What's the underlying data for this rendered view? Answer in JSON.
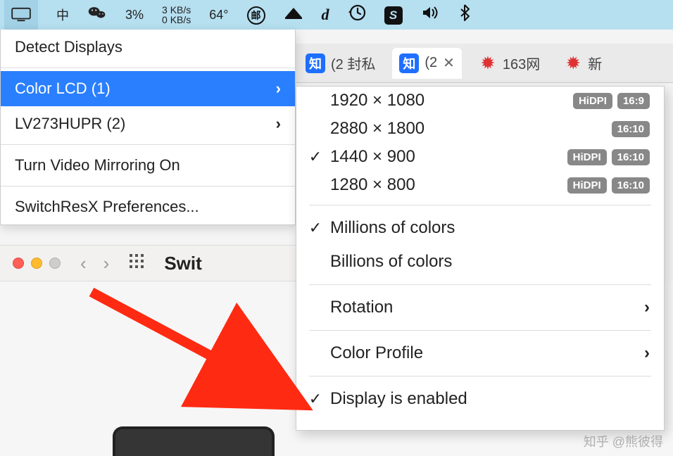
{
  "menubar": {
    "input_method": "中",
    "battery_pct": "3%",
    "net_up": "3 KB/s",
    "net_down": "0 KB/s",
    "temperature": "64°",
    "mail_icon": "邮",
    "d_icon": "d",
    "s_icon": "S"
  },
  "left_menu": {
    "detect": "Detect Displays",
    "displays": [
      {
        "label": "Color LCD (1)",
        "selected": true
      },
      {
        "label": "LV273HUPR (2)",
        "selected": false
      }
    ],
    "mirror": "Turn Video Mirroring On",
    "prefs": "SwitchResX Preferences..."
  },
  "right_menu": {
    "resolutions": [
      {
        "label": "1920 × 1080",
        "checked": false,
        "badges": [
          "HiDPI",
          "16:9"
        ]
      },
      {
        "label": "2880 × 1800",
        "checked": false,
        "badges": [
          "16:10"
        ]
      },
      {
        "label": "1440 × 900",
        "checked": true,
        "badges": [
          "HiDPI",
          "16:10"
        ]
      },
      {
        "label": "1280 × 800",
        "checked": false,
        "badges": [
          "HiDPI",
          "16:10"
        ]
      }
    ],
    "colors": [
      {
        "label": "Millions of colors",
        "checked": true
      },
      {
        "label": "Billions of colors",
        "checked": false
      }
    ],
    "rotation": "Rotation",
    "color_profile": "Color Profile",
    "display_enabled": "Display is enabled"
  },
  "tabs": {
    "t1_icon": "知",
    "t1_label": "(2 封私",
    "t2_icon": "知",
    "t2_label": "(2",
    "t3_label": "163网",
    "t4_label": "新"
  },
  "toolbar": {
    "title": "Swit"
  },
  "watermark": "知乎 @熊彼得"
}
